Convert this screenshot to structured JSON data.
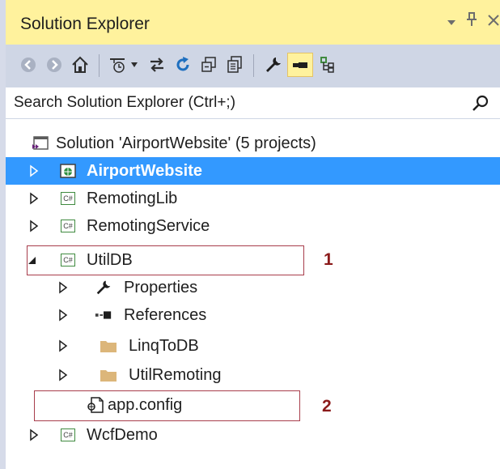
{
  "titlebar": {
    "title": "Solution Explorer"
  },
  "search": {
    "placeholder": "Search Solution Explorer (Ctrl+;)"
  },
  "tree": {
    "solution": "Solution 'AirportWebsite' (5 projects)",
    "items": [
      {
        "label": "AirportWebsite"
      },
      {
        "label": "RemotingLib"
      },
      {
        "label": "RemotingService"
      },
      {
        "label": "UtilDB"
      },
      {
        "label": "Properties"
      },
      {
        "label": "References"
      },
      {
        "label": "LinqToDB"
      },
      {
        "label": "UtilRemoting"
      },
      {
        "label": "app.config"
      },
      {
        "label": "WcfDemo"
      }
    ]
  },
  "annotations": {
    "one": "1",
    "two": "2"
  },
  "colors": {
    "titlebar_bg": "#fff29d",
    "toolbar_bg": "#cfd6e5",
    "selection": "#3399ff",
    "annotation": "#a83d4b"
  }
}
